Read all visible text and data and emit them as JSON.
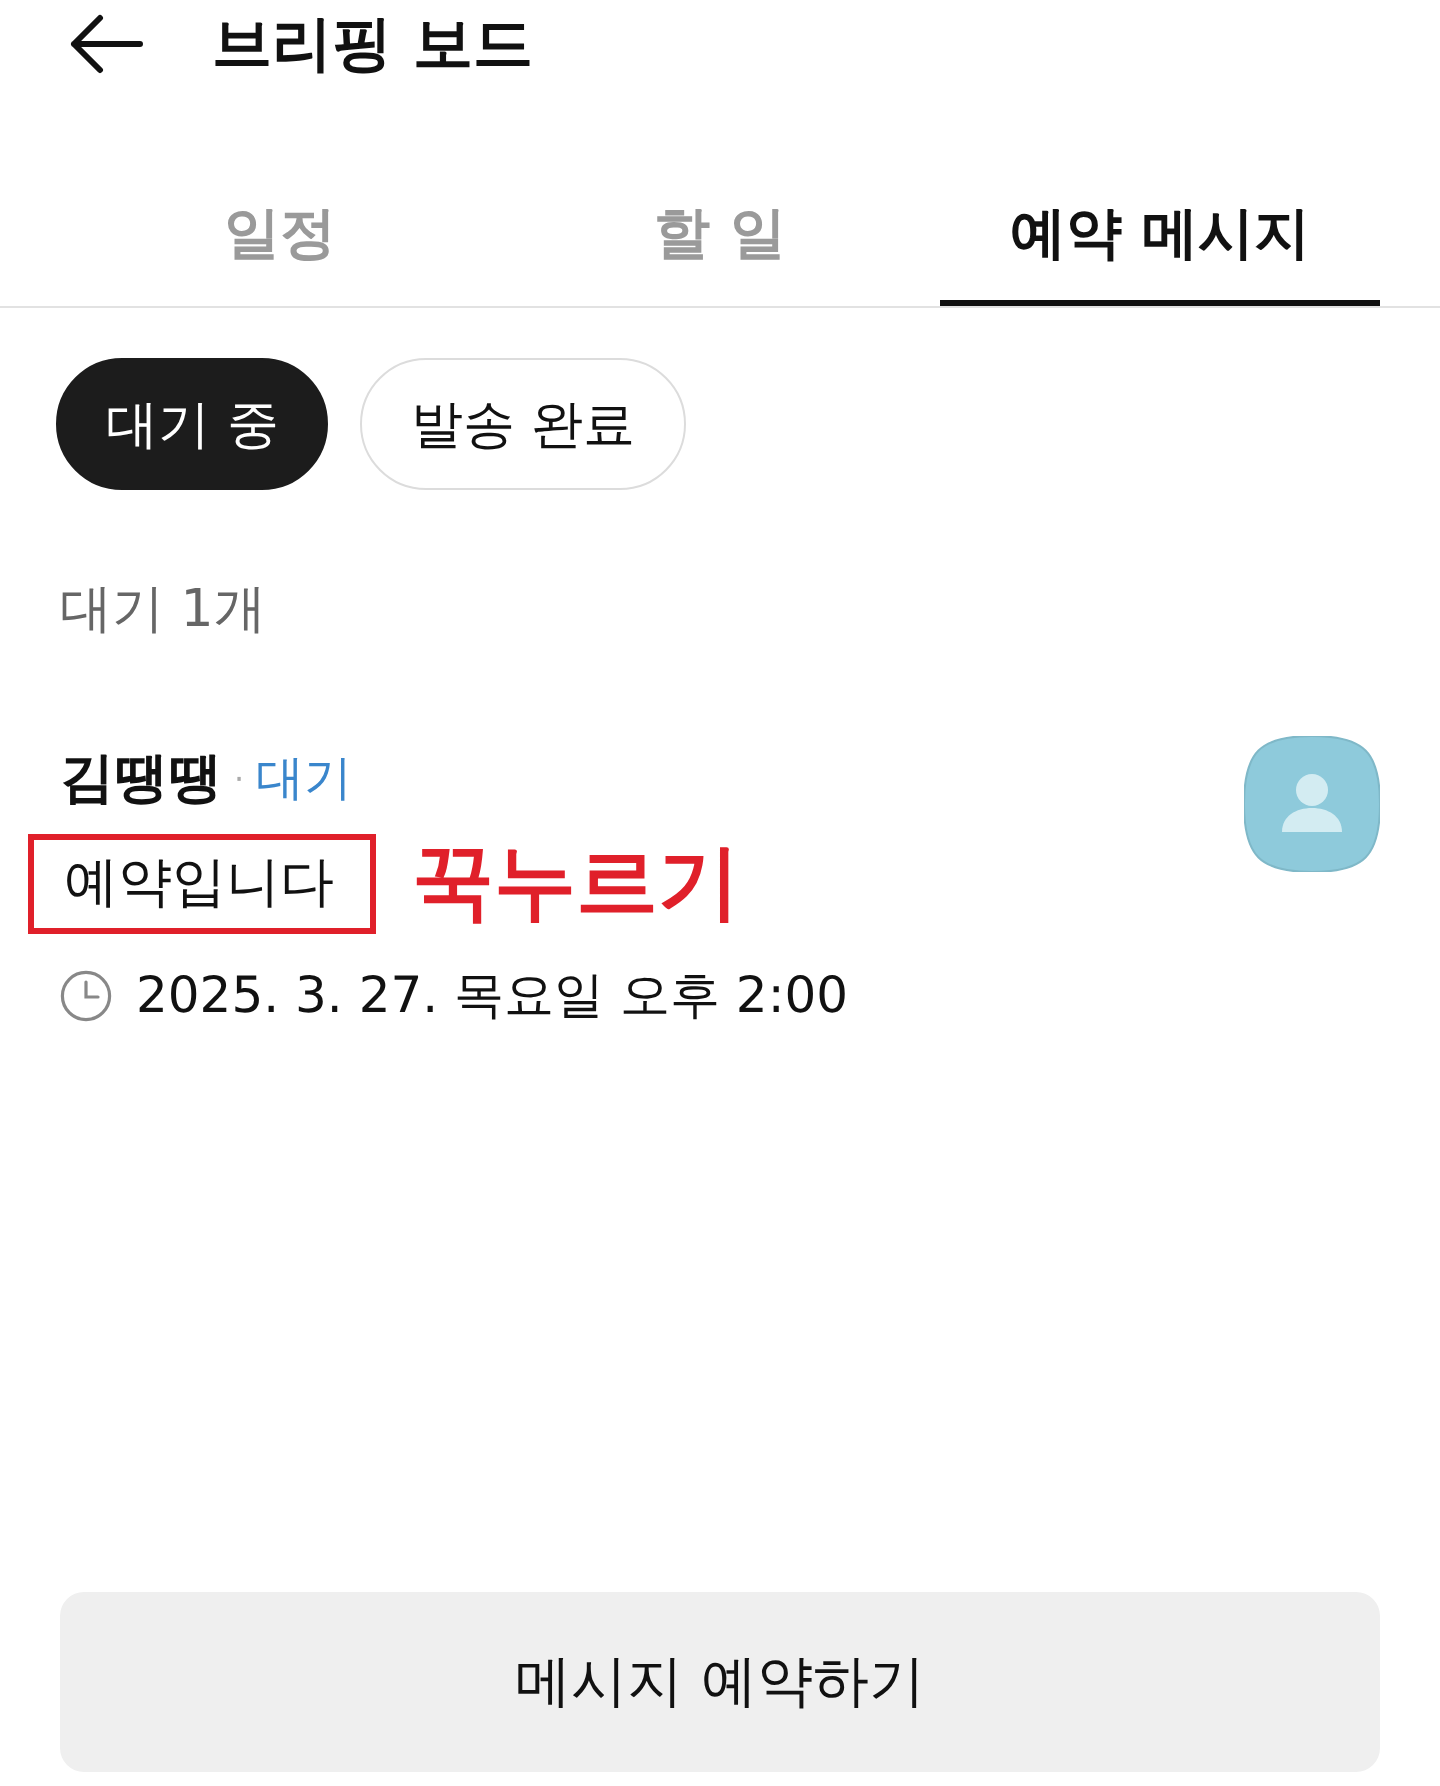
{
  "header": {
    "title": "브리핑 보드"
  },
  "tabs": [
    {
      "label": "일정",
      "selected": false
    },
    {
      "label": "할 일",
      "selected": false
    },
    {
      "label": "예약 메시지",
      "selected": true
    }
  ],
  "filters": [
    {
      "label": "대기 중",
      "selected": true
    },
    {
      "label": "발송 완료",
      "selected": false
    }
  ],
  "count": "대기 1개",
  "messages": [
    {
      "name": "김땡땡",
      "separator": "·",
      "status": "대기",
      "text": "예약입니다",
      "highlighted": true,
      "annotation": "꾹누르기",
      "time": "2025. 3. 27. 목요일 오후 2:00"
    }
  ],
  "primary_button": "메시지 예약하기"
}
